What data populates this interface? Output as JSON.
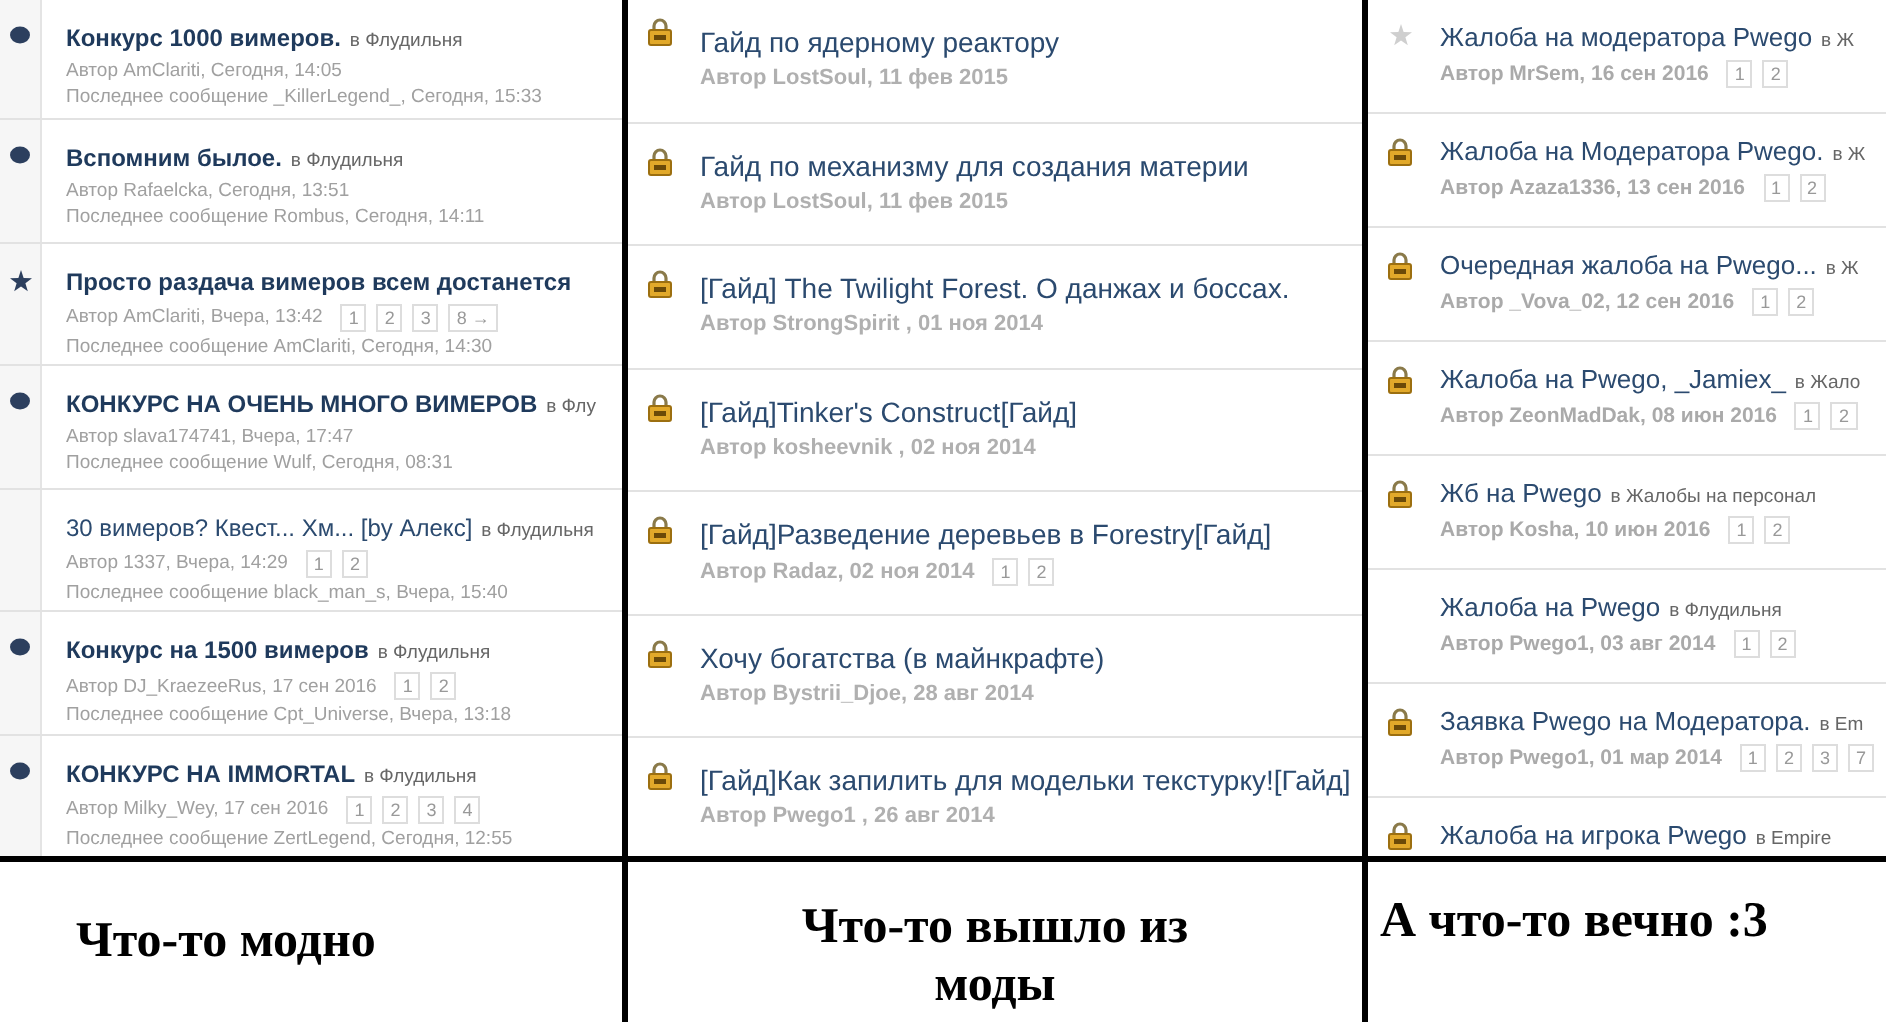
{
  "panels": [
    {
      "caption": "Что-то модно",
      "rows": [
        {
          "kind": "unread",
          "bold": true,
          "title": "Конкурс 1000 вимеров.",
          "forum": "в Флудильня",
          "author": "Автор AmClariti, Сегодня, 14:05",
          "last_post": "Последнее сообщение _KillerLegend_, Сегодня, 15:33"
        },
        {
          "kind": "unread",
          "bold": true,
          "title": "Вспомним былое.",
          "forum": "в Флудильня",
          "author": "Автор Rafaelcka, Сегодня, 13:51",
          "last_post": "Последнее сообщение Rombus, Сегодня, 14:11"
        },
        {
          "kind": "pinned",
          "bold": true,
          "title": "Просто раздача вимеров всем достанется",
          "author": "Автор AmClariti, Вчера, 13:42",
          "pages": [
            "1",
            "2",
            "3",
            "8 →"
          ],
          "last_post": "Последнее сообщение AmClariti, Сегодня, 14:30"
        },
        {
          "kind": "unread",
          "bold": true,
          "title": "КОНКУРС НА ОЧЕНЬ МНОГО ВИМЕРОВ",
          "forum": "в Флу",
          "author": "Автор slava174741, Вчера, 17:47",
          "last_post": "Последнее сообщение Wulf, Сегодня, 08:31"
        },
        {
          "kind": "plain",
          "bold": false,
          "title": "30 вимеров? Квест... Хм... [by Алекс]",
          "forum": "в Флудильня",
          "author": "Автор 1337, Вчера, 14:29",
          "pages": [
            "1",
            "2"
          ],
          "last_post": "Последнее сообщение black_man_s, Вчера, 15:40"
        },
        {
          "kind": "unread",
          "bold": true,
          "title": "Конкурс на 1500 вимеров",
          "forum": "в Флудильня",
          "author": "Автор DJ_KraezeeRus, 17 сен 2016",
          "pages": [
            "1",
            "2"
          ],
          "last_post": "Последнее сообщение Cpt_Universe, Вчера, 13:18"
        },
        {
          "kind": "unread",
          "bold": true,
          "title": "КОНКУРС НА IMMORTAL",
          "forum": "в Флудильня",
          "author": "Автор Milky_Wey, 17 сен 2016",
          "pages": [
            "1",
            "2",
            "3",
            "4"
          ],
          "last_post": "Последнее сообщение ZertLegend, Сегодня, 12:55"
        }
      ]
    },
    {
      "caption": "Что-то вышло из моды",
      "rows": [
        {
          "kind": "locked",
          "bold": false,
          "title": "Гайд по ядерному реактору",
          "author": "Автор LostSoul, 11 фев 2015"
        },
        {
          "kind": "locked",
          "bold": false,
          "title": "Гайд по механизму для создания материи",
          "author": "Автор LostSoul, 11 фев 2015"
        },
        {
          "kind": "locked",
          "bold": false,
          "title": "[Гайд] The Twilight Forest. О данжах и боссах.",
          "author": "Автор StrongSpirit , 01 ноя 2014"
        },
        {
          "kind": "locked",
          "bold": false,
          "title": "[Гайд]Tinker's Construct[Гайд]",
          "author": "Автор kosheevnik , 02 ноя 2014"
        },
        {
          "kind": "locked",
          "bold": false,
          "title": "[Гайд]Разведение деревьев в Forestry[Гайд]",
          "author": "Автор Radaz, 02 ноя 2014",
          "pages": [
            "1",
            "2"
          ]
        },
        {
          "kind": "locked",
          "bold": false,
          "title": "Хочу богатства (в майнкрафте)",
          "author": "Автор Bystrii_Djoe, 28 авг 2014"
        },
        {
          "kind": "locked",
          "bold": false,
          "title": "[Гайд]Как запилить для модельки текстурку![Гайд]",
          "author": "Автор Pwego1 , 26 авг 2014"
        }
      ]
    },
    {
      "caption": "А что-то вечно :3",
      "rows": [
        {
          "kind": "followed",
          "bold": false,
          "title": "Жалоба на модератора Pwego",
          "forum": "в Ж",
          "author": "Автор MrSem, 16 сен 2016",
          "pages": [
            "1",
            "2"
          ]
        },
        {
          "kind": "locked",
          "bold": false,
          "title": "Жалоба на Модератора Pwego.",
          "forum": "в Ж",
          "author": "Автор Azaza1336, 13 сен 2016",
          "pages": [
            "1",
            "2"
          ]
        },
        {
          "kind": "locked",
          "bold": false,
          "title": "Очередная жалоба на Pwego...",
          "forum": "в Ж",
          "author": "Автор _Vova_02, 12 сен 2016",
          "pages": [
            "1",
            "2"
          ]
        },
        {
          "kind": "locked",
          "bold": false,
          "title": "Жалоба на Pwego, _Jamiex_",
          "forum": "в Жало",
          "author": "Автор ZeonMadDak, 08 июн 2016",
          "pages": [
            "1",
            "2"
          ]
        },
        {
          "kind": "locked",
          "bold": false,
          "title": "Жб на Pwego",
          "forum": "в Жалобы на персонал",
          "author": "Автор Kosha, 10 июн 2016",
          "pages": [
            "1",
            "2"
          ]
        },
        {
          "kind": "plain",
          "bold": false,
          "title": "Жалоба на Pwego",
          "forum": "в Флудильня",
          "author": "Автор Pwego1, 03 авг 2014",
          "pages": [
            "1",
            "2"
          ]
        },
        {
          "kind": "locked",
          "bold": false,
          "title": "Заявка Pwego на Модератора.",
          "forum": "в Em",
          "author": "Автор Pwego1, 01 мар 2014",
          "pages": [
            "1",
            "2",
            "3",
            "7"
          ]
        },
        {
          "kind": "locked",
          "bold": false,
          "title": "Жалоба на игрока Pwego",
          "forum": "в Empire"
        }
      ]
    }
  ]
}
